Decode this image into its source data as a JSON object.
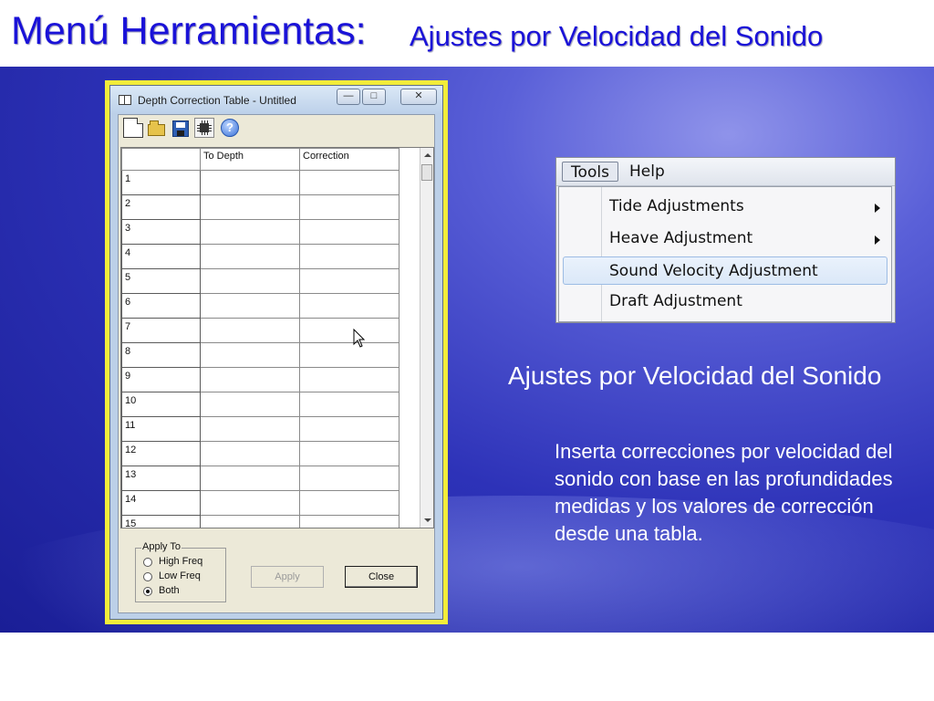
{
  "slide": {
    "title_main": "Menú Herramientas:",
    "title_sub": "Ajustes por Velocidad del Sonido",
    "heading": "Ajustes por Velocidad del Sonido",
    "body": "Inserta correcciones por velocidad del sonido con base en las profundidades medidas y los valores de corrección desde una tabla."
  },
  "window": {
    "title": "Depth Correction Table - Untitled",
    "toolbar_icons": [
      "new-file-icon",
      "open-folder-icon",
      "save-disk-icon",
      "calculator-chip-icon",
      "help-icon"
    ],
    "help_glyph": "?",
    "grid": {
      "columns": [
        "",
        "To Depth",
        "Correction"
      ],
      "rows": [
        "1",
        "2",
        "3",
        "4",
        "5",
        "6",
        "7",
        "8",
        "9",
        "10",
        "11",
        "12",
        "13",
        "14",
        "15"
      ]
    },
    "apply_to": {
      "legend": "Apply To",
      "options": [
        "High Freq",
        "Low Freq",
        "Both"
      ],
      "selected": "Both"
    },
    "apply_label": "Apply",
    "close_label": "Close"
  },
  "menu": {
    "bar": [
      "Tools",
      "Help"
    ],
    "items": [
      {
        "label": "Tide Adjustments",
        "submenu": true
      },
      {
        "label": "Heave Adjustment",
        "submenu": true
      },
      {
        "label": "Sound Velocity Adjustment",
        "submenu": false,
        "highlighted": true
      },
      {
        "label": "Draft Adjustment",
        "submenu": false
      }
    ]
  },
  "colors": {
    "title": "#1a12d8",
    "slide_background": "#2d32b8",
    "window_highlight": "#f2ec3a",
    "body_text": "#ffffff"
  }
}
